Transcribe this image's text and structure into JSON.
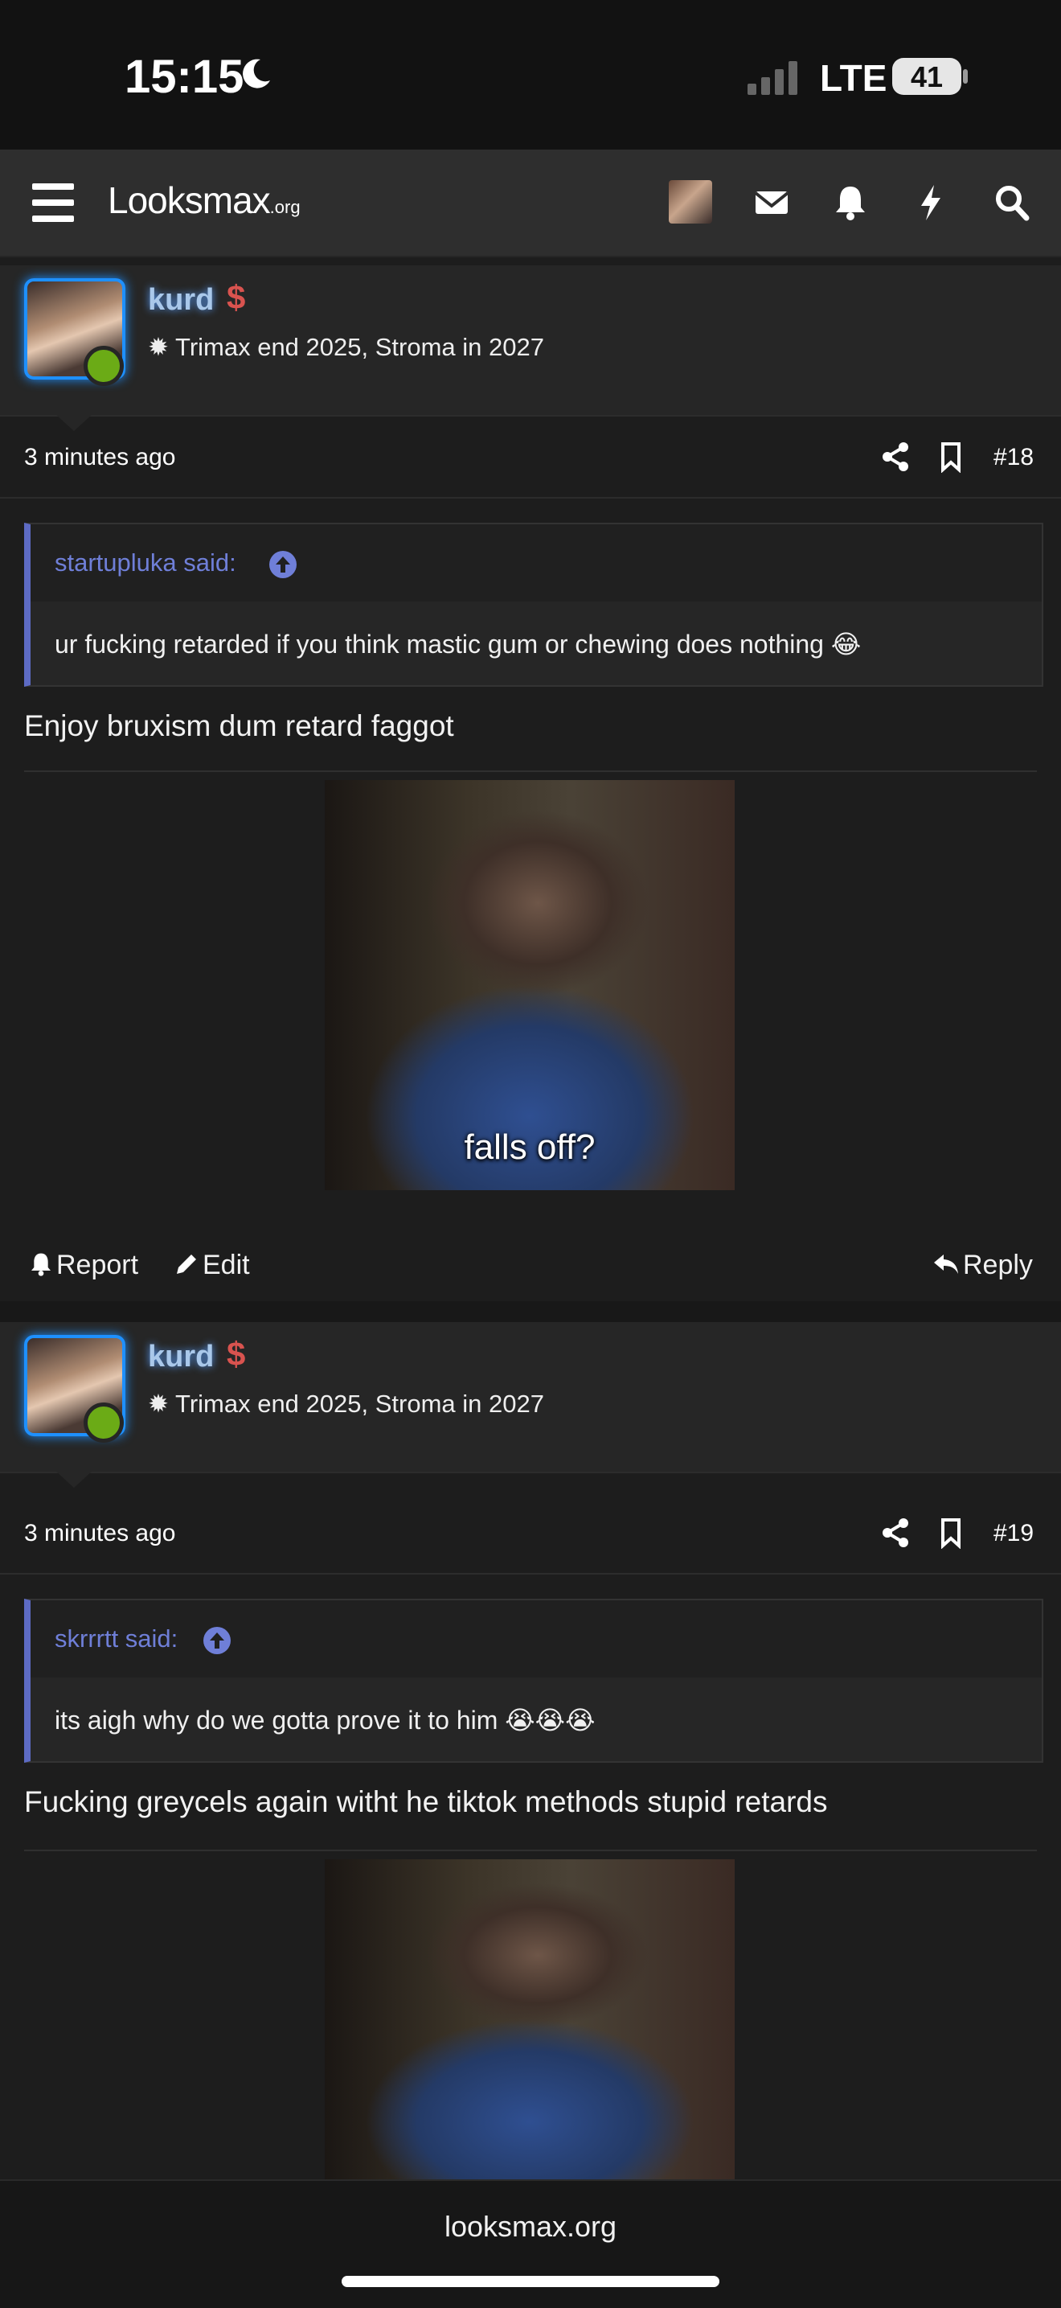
{
  "status_bar": {
    "time": "15:15",
    "network": "LTE",
    "battery": "41"
  },
  "nav": {
    "logo_main": "Looksmax",
    "logo_suffix": ".org"
  },
  "posts": [
    {
      "username": "kurd",
      "user_title": "✹ Trimax end 2025, Stroma in 2027",
      "time": "3 minutes ago",
      "number": "#18",
      "quote_author": "startupluka said:",
      "quote_text": "ur fucking retarded if you think mastic gum or chewing does nothing 😂",
      "body": "Enjoy bruxism dum retard faggot",
      "gif_caption": "falls off?"
    },
    {
      "username": "kurd",
      "user_title": "✹ Trimax end 2025, Stroma in 2027",
      "time": "3 minutes ago",
      "number": "#19",
      "quote_author": "skrrrtt said:",
      "quote_text": "its aigh why do we gotta prove it to him 😭😭😭",
      "body": "Fucking greycels again witht he tiktok methods stupid retards",
      "gif_caption": ""
    }
  ],
  "actions": {
    "report": "Report",
    "edit": "Edit",
    "reply": "Reply"
  },
  "footer": {
    "url": "looksmax.org"
  }
}
